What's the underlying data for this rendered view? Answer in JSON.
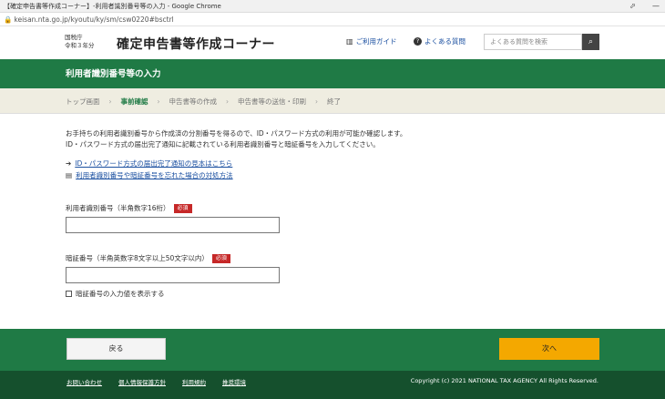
{
  "browser": {
    "window_title": "【確定申告書等作成コーナー】-利用者識別番号等の入力 - Google Chrome",
    "url": "keisan.nta.go.jp/kyoutu/ky/sm/csw0220#bsctrl",
    "window_controls": [
      "⬀",
      "—"
    ]
  },
  "header": {
    "org_line1": "国税庁",
    "org_line2": "令和３年分",
    "title": "確定申告書等作成コーナー",
    "guide_link": "ご利用ガイド",
    "faq_link": "よくある質問",
    "search_placeholder": "よくある質問を検索",
    "icons": {
      "guide": "book-icon",
      "faq": "question-icon",
      "search": "search-icon"
    }
  },
  "page": {
    "heading": "利用者識別番号等の入力"
  },
  "steps": {
    "items": [
      "トップ画面",
      "事前確認",
      "申告書等の作成",
      "申告書等の送信・印刷",
      "終了"
    ],
    "active_index": 1
  },
  "content": {
    "intro_line1": "お手持ちの利用者識別番号から作成済の分割番号を得るので、ID・パスワード方式の利用が可能か確認します。",
    "intro_line2": "ID・パスワード方式の届出完了通知に記載されている利用者識別番号と暗証番号を入力してください。",
    "link_id_password": "ID・パスワード方式の届出完了通知の見本はこちら",
    "link_forgot": "利用者識別番号や暗証番号を忘れた場合の対処方法",
    "field_user_id_label": "利用者識別番号（半角数字16桁）",
    "field_password_label": "暗証番号（半角英数字8文字以上50文字以内）",
    "required_badge": "必須",
    "user_id_value": "",
    "password_value": "",
    "show_password_label": "暗証番号の入力値を表示する",
    "show_password_checked": false
  },
  "actions": {
    "back_label": "戻る",
    "next_label": "次へ"
  },
  "footer": {
    "links": [
      "お問い合わせ",
      "個人情報保護方針",
      "利用規約",
      "推奨環境"
    ],
    "copyright": "Copyright (c) 2021 NATIONAL TAX AGENCY All Rights Reserved."
  },
  "colors": {
    "brand_green": "#1f7a45",
    "footer_green": "#15502d",
    "next_button": "#f4a800",
    "required_badge": "#c62828",
    "step_background": "#efede1"
  }
}
